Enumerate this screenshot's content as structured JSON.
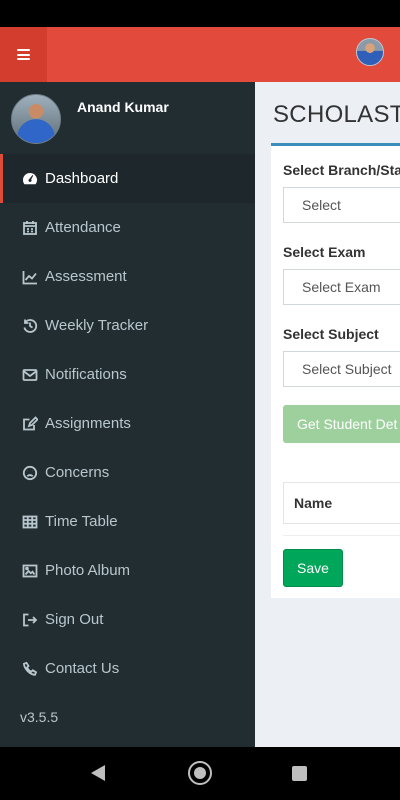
{
  "header": {
    "menu_toggle_icon": "hamburger-icon",
    "accent_color": "#e24b3b"
  },
  "user": {
    "name": "Anand Kumar"
  },
  "sidebar": {
    "items": [
      {
        "label": "Dashboard",
        "icon": "dashboard-icon",
        "active": true
      },
      {
        "label": "Attendance",
        "icon": "calendar-icon"
      },
      {
        "label": "Assessment",
        "icon": "line-chart-icon"
      },
      {
        "label": "Weekly Tracker",
        "icon": "history-icon"
      },
      {
        "label": "Notifications",
        "icon": "envelope-icon"
      },
      {
        "label": "Assignments",
        "icon": "edit-icon"
      },
      {
        "label": "Concerns",
        "icon": "frown-icon"
      },
      {
        "label": "Time Table",
        "icon": "table-icon"
      },
      {
        "label": "Photo Album",
        "icon": "image-icon"
      },
      {
        "label": "Sign Out",
        "icon": "sign-out-icon"
      },
      {
        "label": "Contact Us",
        "icon": "phone-icon"
      }
    ],
    "version": "v3.5.5"
  },
  "main": {
    "title": "SCHOLASTI",
    "form": {
      "branch_label": "Select Branch/Sta",
      "branch_value": "Select",
      "exam_label": "Select Exam",
      "exam_value": "Select Exam",
      "subject_label": "Select Subject",
      "subject_value": "Select Subject",
      "get_details_label": "Get Student Det"
    },
    "table": {
      "columns": [
        "Name"
      ]
    },
    "save_label": "Save"
  }
}
